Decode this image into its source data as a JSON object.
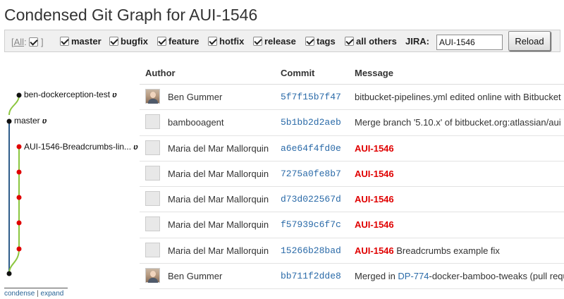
{
  "page_title": "Condensed Git Graph for AUI-1546",
  "filters": {
    "all_label": "All",
    "bracket_open": "[",
    "bracket_close": "]",
    "items": [
      "master",
      "bugfix",
      "feature",
      "hotfix",
      "release",
      "tags",
      "all others"
    ],
    "jira_label": "JIRA:",
    "jira_value": "AUI-1546",
    "reload_label": "Reload"
  },
  "graph": {
    "colors": {
      "master": "#2f5d8a",
      "feature": "#8cc63f",
      "commit_dot": "#e00000",
      "head_dot": "#111111"
    },
    "branches": [
      {
        "name": "ben-dockerception-test",
        "icon": "ʋ"
      },
      {
        "name": "master",
        "icon": "ʋ"
      },
      {
        "name": "AUI-1546-Breadcrumbs-lin...",
        "icon": "ʋ"
      }
    ]
  },
  "table": {
    "headers": {
      "author": "Author",
      "commit": "Commit",
      "message": "Message"
    },
    "rows": [
      {
        "avatar": "photo",
        "author": "Ben Gummer",
        "commit": "5f7f15b7f47",
        "jira": "",
        "message": "bitbucket-pipelines.yml edited online with Bitbucket",
        "link": "",
        "message_tail": ""
      },
      {
        "avatar": "default",
        "author": "bambooagent",
        "commit": "5b1bb2d2aeb",
        "jira": "",
        "message": "Merge branch '5.10.x' of bitbucket.org:atlassian/aui",
        "link": "",
        "message_tail": ""
      },
      {
        "avatar": "default",
        "author": "Maria del Mar Mallorquin",
        "commit": "a6e64f4fd0e",
        "jira": "AUI-1546",
        "message": "",
        "link": "",
        "message_tail": ""
      },
      {
        "avatar": "default",
        "author": "Maria del Mar Mallorquin",
        "commit": "7275a0fe8b7",
        "jira": "AUI-1546",
        "message": "",
        "link": "",
        "message_tail": ""
      },
      {
        "avatar": "default",
        "author": "Maria del Mar Mallorquin",
        "commit": "d73d022567d",
        "jira": "AUI-1546",
        "message": "",
        "link": "",
        "message_tail": ""
      },
      {
        "avatar": "default",
        "author": "Maria del Mar Mallorquin",
        "commit": "f57939c6f7c",
        "jira": "AUI-1546",
        "message": "",
        "link": "",
        "message_tail": ""
      },
      {
        "avatar": "default",
        "author": "Maria del Mar Mallorquin",
        "commit": "15266b28bad",
        "jira": "AUI-1546",
        "message": " Breadcrumbs example fix",
        "link": "",
        "message_tail": ""
      },
      {
        "avatar": "photo",
        "author": "Ben Gummer",
        "commit": "bb711f2dde8",
        "jira": "",
        "message": "Merged in ",
        "link": "DP-774",
        "message_tail": "-docker-bamboo-tweaks (pull requ"
      }
    ]
  },
  "footer": {
    "condense_label": "condense",
    "separator": " | ",
    "expand_label": "expand"
  }
}
